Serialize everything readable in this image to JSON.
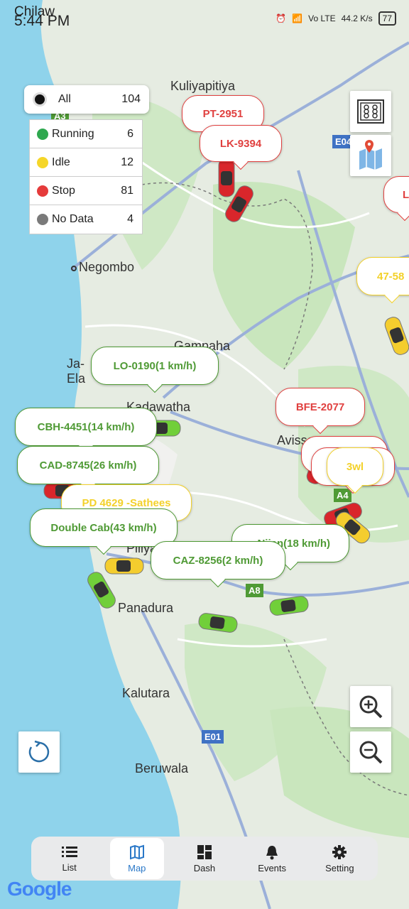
{
  "status_bar": {
    "carrier": "Chilaw",
    "time": "5:44 PM",
    "net_speed": "44.2 K/s",
    "network": "Vo LTE",
    "battery": "77"
  },
  "filter_all": {
    "label": "All",
    "count": "104"
  },
  "filters": [
    {
      "label": "Running",
      "count": "6",
      "color": "#2fa84f"
    },
    {
      "label": "Idle",
      "count": "12",
      "color": "#f5d629"
    },
    {
      "label": "Stop",
      "count": "81",
      "color": "#e53b3b"
    },
    {
      "label": "No Data",
      "count": "4",
      "color": "#7a7a7a"
    }
  ],
  "places": [
    "Kuliyapitiya",
    "Negombo",
    "Gampaha",
    "Ja-Ela",
    "Kadawatha",
    "Avissawella",
    "Piliyandala",
    "Panadura",
    "Kalutara",
    "Beruwala"
  ],
  "road_shields": [
    "E04",
    "E01",
    "A8",
    "A4",
    "A3"
  ],
  "vehicle_tags": [
    {
      "text": "PT-2951",
      "color": "red"
    },
    {
      "text": "LK-9394",
      "color": "red"
    },
    {
      "text": "L",
      "color": "red"
    },
    {
      "text": "47-58",
      "color": "yellow"
    },
    {
      "text": "LO-0190(1 km/h)",
      "color": "green"
    },
    {
      "text": "BFE-2077",
      "color": "red"
    },
    {
      "text": "CBH-4451(14 km/h)",
      "color": "green"
    },
    {
      "text": "CAD-8745(26 km/h)",
      "color": "green"
    },
    {
      "text": "PD 4629 -Sathees",
      "color": "yellow"
    },
    {
      "text": "3wl",
      "color": "yellow"
    },
    {
      "text": "Double Cab(43 km/h)",
      "color": "green"
    },
    {
      "text": "Nijan(18 km/h)",
      "color": "green"
    },
    {
      "text": "CAZ-8256(2 km/h)",
      "color": "green"
    }
  ],
  "nav": [
    {
      "label": "List",
      "icon": "list-icon"
    },
    {
      "label": "Map",
      "icon": "map-icon",
      "active": true
    },
    {
      "label": "Dash",
      "icon": "dashboard-icon"
    },
    {
      "label": "Events",
      "icon": "bell-icon"
    },
    {
      "label": "Setting",
      "icon": "gear-icon"
    }
  ],
  "google_logo": "Google"
}
